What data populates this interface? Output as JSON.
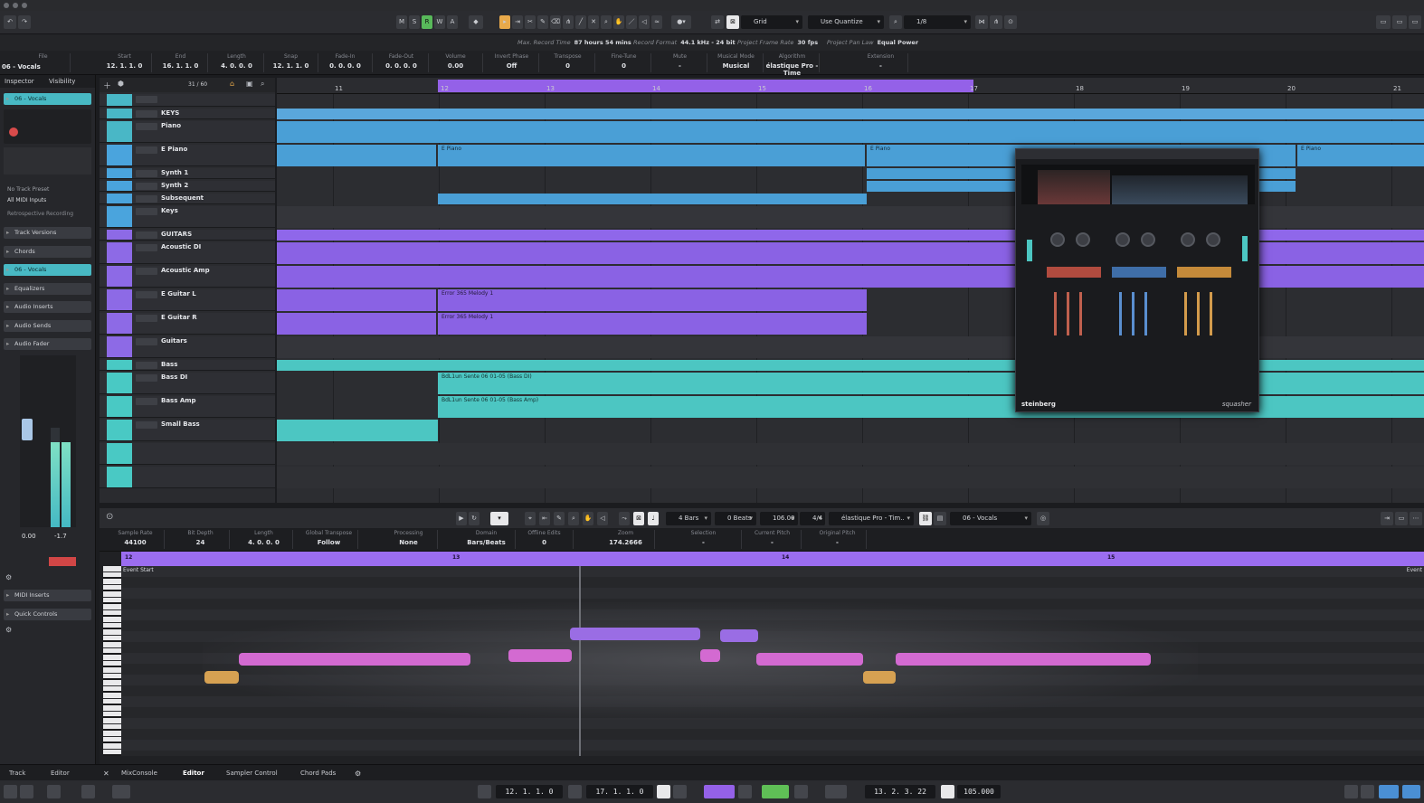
{
  "toolbar": {
    "mode_buttons": [
      "M",
      "S",
      "R",
      "W",
      "A"
    ],
    "snap_type": "Grid",
    "quantize_mode": "Use Quantize",
    "quantize_value": "1/8"
  },
  "status_bar": {
    "max_record_time_label": "Max. Record Time",
    "max_record_time_value": "87 hours 54 mins",
    "record_format_label": "Record Format",
    "record_format_value": "44.1 kHz - 24 bit",
    "frame_rate_label": "Project Frame Rate",
    "frame_rate_value": "30 fps",
    "pan_law_label": "Project Pan Law",
    "pan_law_value": "Equal Power"
  },
  "event_line": {
    "track_name": "06 - Vocals",
    "fields": [
      {
        "label": "File",
        "value": ""
      },
      {
        "label": "Start",
        "value": "12. 1. 1. 0"
      },
      {
        "label": "End",
        "value": "16. 1. 1. 0"
      },
      {
        "label": "Length",
        "value": "4. 0. 0. 0"
      },
      {
        "label": "Snap",
        "value": "12. 1. 1. 0"
      },
      {
        "label": "Fade-In",
        "value": "0. 0. 0. 0"
      },
      {
        "label": "Fade-Out",
        "value": "0. 0. 0. 0"
      },
      {
        "label": "Volume",
        "value": "0.00"
      },
      {
        "label": "Invert Phase",
        "value": "Off"
      },
      {
        "label": "Transpose",
        "value": "0"
      },
      {
        "label": "Fine-Tune",
        "value": "0"
      },
      {
        "label": "Mute",
        "value": "-"
      },
      {
        "label": "Musical Mode",
        "value": "Musical"
      },
      {
        "label": "Algorithm",
        "value": "élastique Pro - Time"
      },
      {
        "label": "Extension",
        "value": "-"
      }
    ]
  },
  "inspector": {
    "tabs": [
      "Inspector",
      "Visibility"
    ],
    "track_name": "06 - Vocals",
    "no_track_preset": "No Track Preset",
    "midi_inputs": "All MIDI Inputs",
    "retro_record": "Retrospective Recording",
    "sections": [
      "Track Versions",
      "Chords",
      "06 - Vocals",
      "Equalizers",
      "Audio Inserts",
      "Audio Sends",
      "Audio Fader",
      "MIDI Inserts",
      "Quick Controls"
    ],
    "fader_value": "0.00",
    "fader_peak": "-1.7"
  },
  "tracklist": {
    "counter": "31 / 60",
    "tracks": [
      {
        "name": "",
        "color": "#49b7c6"
      },
      {
        "name": "KEYS",
        "color": "#49b7c6"
      },
      {
        "name": "Piano",
        "color": "#49b7c6"
      },
      {
        "name": "E Piano",
        "color": "#4aa4dd"
      },
      {
        "name": "Synth 1",
        "color": "#4aa4dd"
      },
      {
        "name": "Synth 2",
        "color": "#4aa4dd"
      },
      {
        "name": "Subsequent",
        "color": "#4aa4dd"
      },
      {
        "name": "Keys",
        "color": "#4aa4dd"
      },
      {
        "name": "GUITARS",
        "color": "#8d6ae6"
      },
      {
        "name": "Acoustic DI",
        "color": "#8d6ae6"
      },
      {
        "name": "Acoustic Amp",
        "color": "#8d6ae6"
      },
      {
        "name": "E Guitar L",
        "color": "#8d6ae6"
      },
      {
        "name": "E Guitar R",
        "color": "#8d6ae6"
      },
      {
        "name": "Guitars",
        "color": "#8d6ae6"
      },
      {
        "name": "Bass",
        "color": "#49c9c4"
      },
      {
        "name": "Bass DI",
        "color": "#49c9c4"
      },
      {
        "name": "Bass Amp",
        "color": "#49c9c4"
      },
      {
        "name": "Small Bass",
        "color": "#49c9c4"
      }
    ]
  },
  "ruler_bars": [
    "11",
    "12",
    "13",
    "14",
    "15",
    "16",
    "17",
    "18",
    "19",
    "20",
    "21"
  ],
  "part_labels": {
    "epiano": "E Piano",
    "guitar_l": "Error 365 Melody 1",
    "guitar_r": "Error 365 Melody 1",
    "bass_di": "BdL1un Sente 06 01-05 (Bass DI)",
    "bass_amp": "BdL1un Sente 06 01-05 (Bass Amp)"
  },
  "plugin": {
    "brand": "steinberg",
    "model": "squasher"
  },
  "editor": {
    "quantize": "4 Bars",
    "beats": "0 Beats",
    "tempo": "106.00",
    "signature": "4/4",
    "algorithm": "élastique Pro - Tim..",
    "track": "06 - Vocals",
    "info": [
      {
        "label": "Sample Rate",
        "value": "44100"
      },
      {
        "label": "Bit Depth",
        "value": "24"
      },
      {
        "label": "Length",
        "value": "4. 0. 0. 0"
      },
      {
        "label": "Global Transpose",
        "value": "Follow"
      },
      {
        "label": "Processing",
        "value": "None"
      },
      {
        "label": "Domain",
        "value": "Bars/Beats"
      },
      {
        "label": "Offline Edits",
        "value": "0"
      },
      {
        "label": "Zoom",
        "value": "174.2666"
      },
      {
        "label": "Selection",
        "value": "-"
      },
      {
        "label": "Current Pitch",
        "value": "-"
      },
      {
        "label": "Original Pitch",
        "value": "-"
      }
    ],
    "ruler_bars": [
      "12",
      "13",
      "14",
      "15"
    ],
    "event_start": "Event Start",
    "event_end": "Event"
  },
  "bottom_tabs": [
    "Track",
    "Editor",
    "MixConsole",
    "Editor",
    "Sampler Control",
    "Chord Pads"
  ],
  "transport": {
    "left_locator": "12. 1. 1. 0",
    "right_locator": "17. 1. 1. 0",
    "position": "13. 2. 3. 22",
    "tempo": "105.000"
  }
}
